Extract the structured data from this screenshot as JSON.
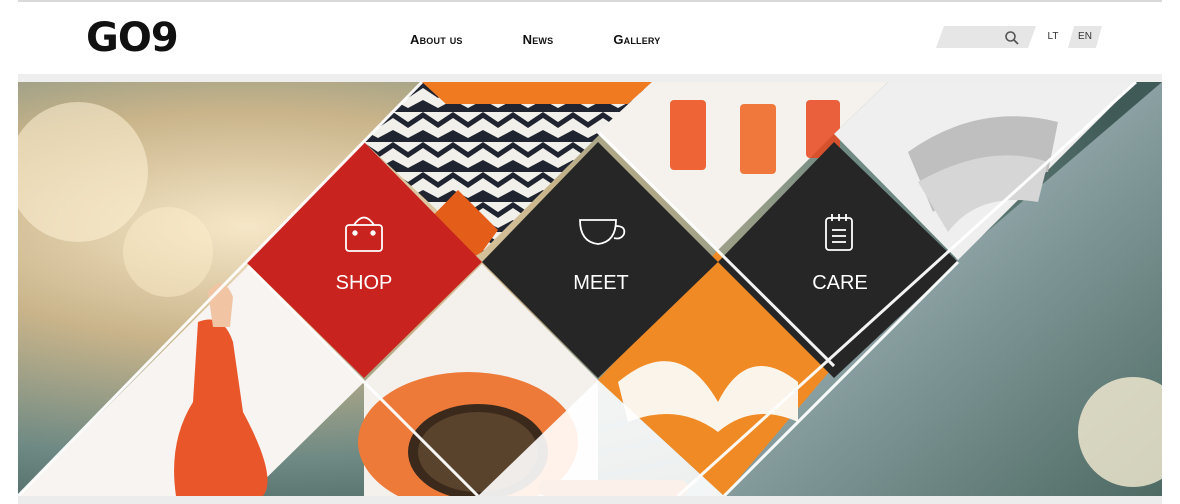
{
  "header": {
    "logo": "GO9",
    "nav": [
      "About us",
      "News",
      "Gallery"
    ],
    "languages": [
      "LT",
      "EN"
    ]
  },
  "hero": {
    "tiles": [
      {
        "label": "SHOP",
        "icon": "shopping-bag-icon",
        "color": "#c8231f"
      },
      {
        "label": "MEET",
        "icon": "coffee-cup-icon",
        "color": "#262626"
      },
      {
        "label": "CARE",
        "icon": "notepad-icon",
        "color": "#262626"
      }
    ]
  },
  "colors": {
    "accent": "#c8231f",
    "orange": "#f08a24",
    "dark": "#262626"
  }
}
